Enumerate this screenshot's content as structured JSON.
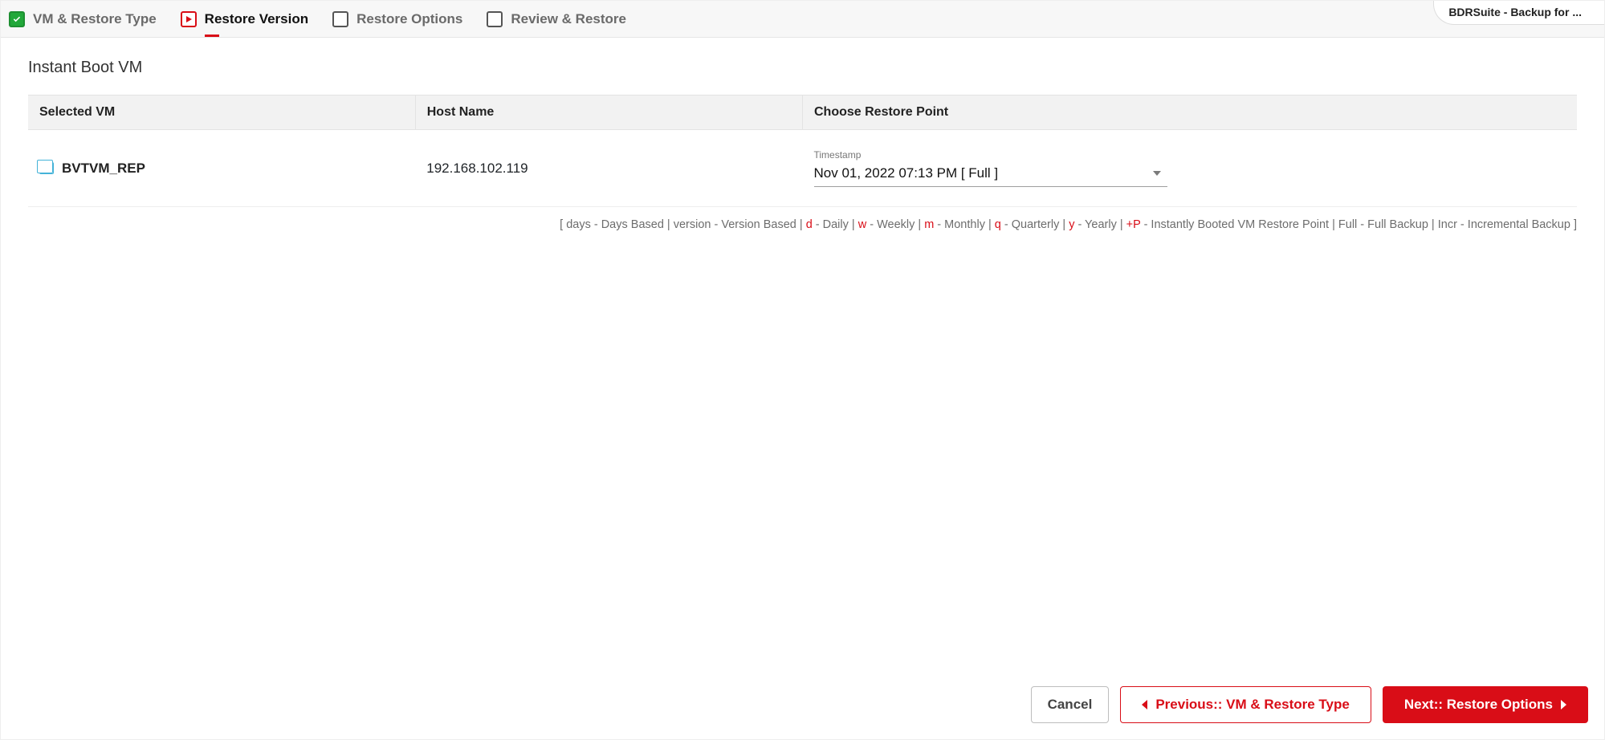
{
  "browser_tab": "BDRSuite - Backup for ...",
  "wizard": {
    "steps": [
      {
        "label": "VM & Restore Type",
        "state": "completed"
      },
      {
        "label": "Restore Version",
        "state": "current"
      },
      {
        "label": "Restore Options",
        "state": "upcoming"
      },
      {
        "label": "Review & Restore",
        "state": "upcoming"
      }
    ]
  },
  "page_title": "Instant Boot VM",
  "table": {
    "headers": {
      "vm": "Selected VM",
      "host": "Host Name",
      "restore": "Choose Restore Point"
    },
    "rows": [
      {
        "vm_name": "BVTVM_REP",
        "host": "192.168.102.119",
        "timestamp_label": "Timestamp",
        "timestamp_value": "Nov 01, 2022 07:13 PM [ Full ]"
      }
    ]
  },
  "legend": {
    "parts": [
      "[ days - Days Based | version - Version Based | ",
      "d",
      " - Daily | ",
      "w",
      " - Weekly | ",
      "m",
      " - Monthly | ",
      "q",
      " - Quarterly | ",
      "y",
      " - Yearly | ",
      "+P",
      " - Instantly Booted VM Restore Point | Full - Full Backup | Incr - Incremental Backup ]"
    ]
  },
  "footer": {
    "cancel": "Cancel",
    "previous": "Previous:: VM & Restore Type",
    "next": "Next:: Restore Options"
  }
}
